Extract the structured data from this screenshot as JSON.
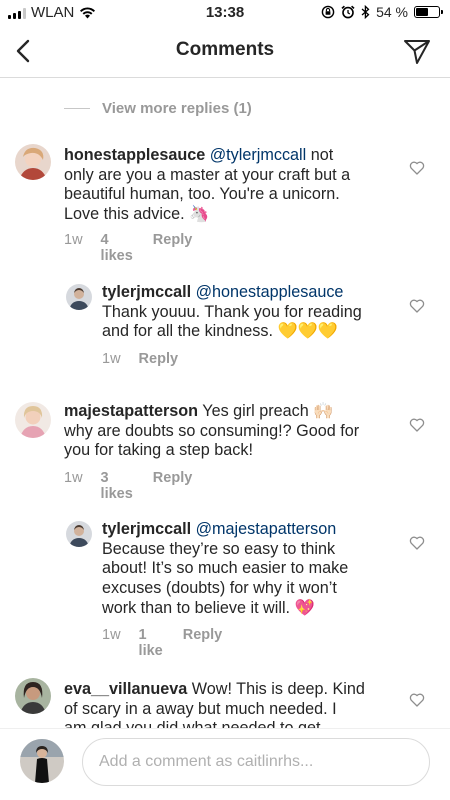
{
  "status_bar": {
    "carrier": "WLAN",
    "time": "13:38",
    "battery_percent": "54 %",
    "battery_level": 0.54
  },
  "header": {
    "title": "Comments"
  },
  "view_more_replies": "View more replies (1)",
  "comments": [
    {
      "username": "honestapplesauce",
      "mention": "@tylerjmccall",
      "lines": [
        "not",
        "only are you a master at your craft but a",
        "beautiful human, too. You're a unicorn.",
        "Love this advice. 🦄"
      ],
      "time": "1w",
      "likes": "4 likes",
      "reply": "Reply"
    },
    {
      "username": "tylerjmccall",
      "mention": "@honestapplesauce",
      "lines": [
        "",
        "Thank youuu. Thank you for reading",
        "and for all the kindness. 💛💛💛"
      ],
      "time": "1w",
      "reply": "Reply"
    },
    {
      "username": "majestapatterson",
      "lines": [
        "Yes girl preach 🙌🏻",
        "why are doubts so consuming!? Good for",
        "you for taking a step back!"
      ],
      "time": "1w",
      "likes": "3 likes",
      "reply": "Reply"
    },
    {
      "username": "tylerjmccall",
      "mention": "@majestapatterson",
      "lines": [
        "",
        "Because they’re so easy to think",
        "about! It’s so much easier to make",
        "excuses (doubts) for why it won’t",
        "work than to believe it will. 💖"
      ],
      "time": "1w",
      "likes": "1 like",
      "reply": "Reply"
    },
    {
      "username": "eva__villanueva",
      "lines": [
        "Wow! This is deep.  Kind",
        "of scary in a away but much needed. I",
        "am glad you did what needed to get"
      ]
    }
  ],
  "input": {
    "placeholder": "Add a comment as caitlinrhs..."
  },
  "colors": {
    "link": "#003569",
    "muted": "#999999",
    "text": "#262626",
    "border": "#dbdbdb"
  }
}
